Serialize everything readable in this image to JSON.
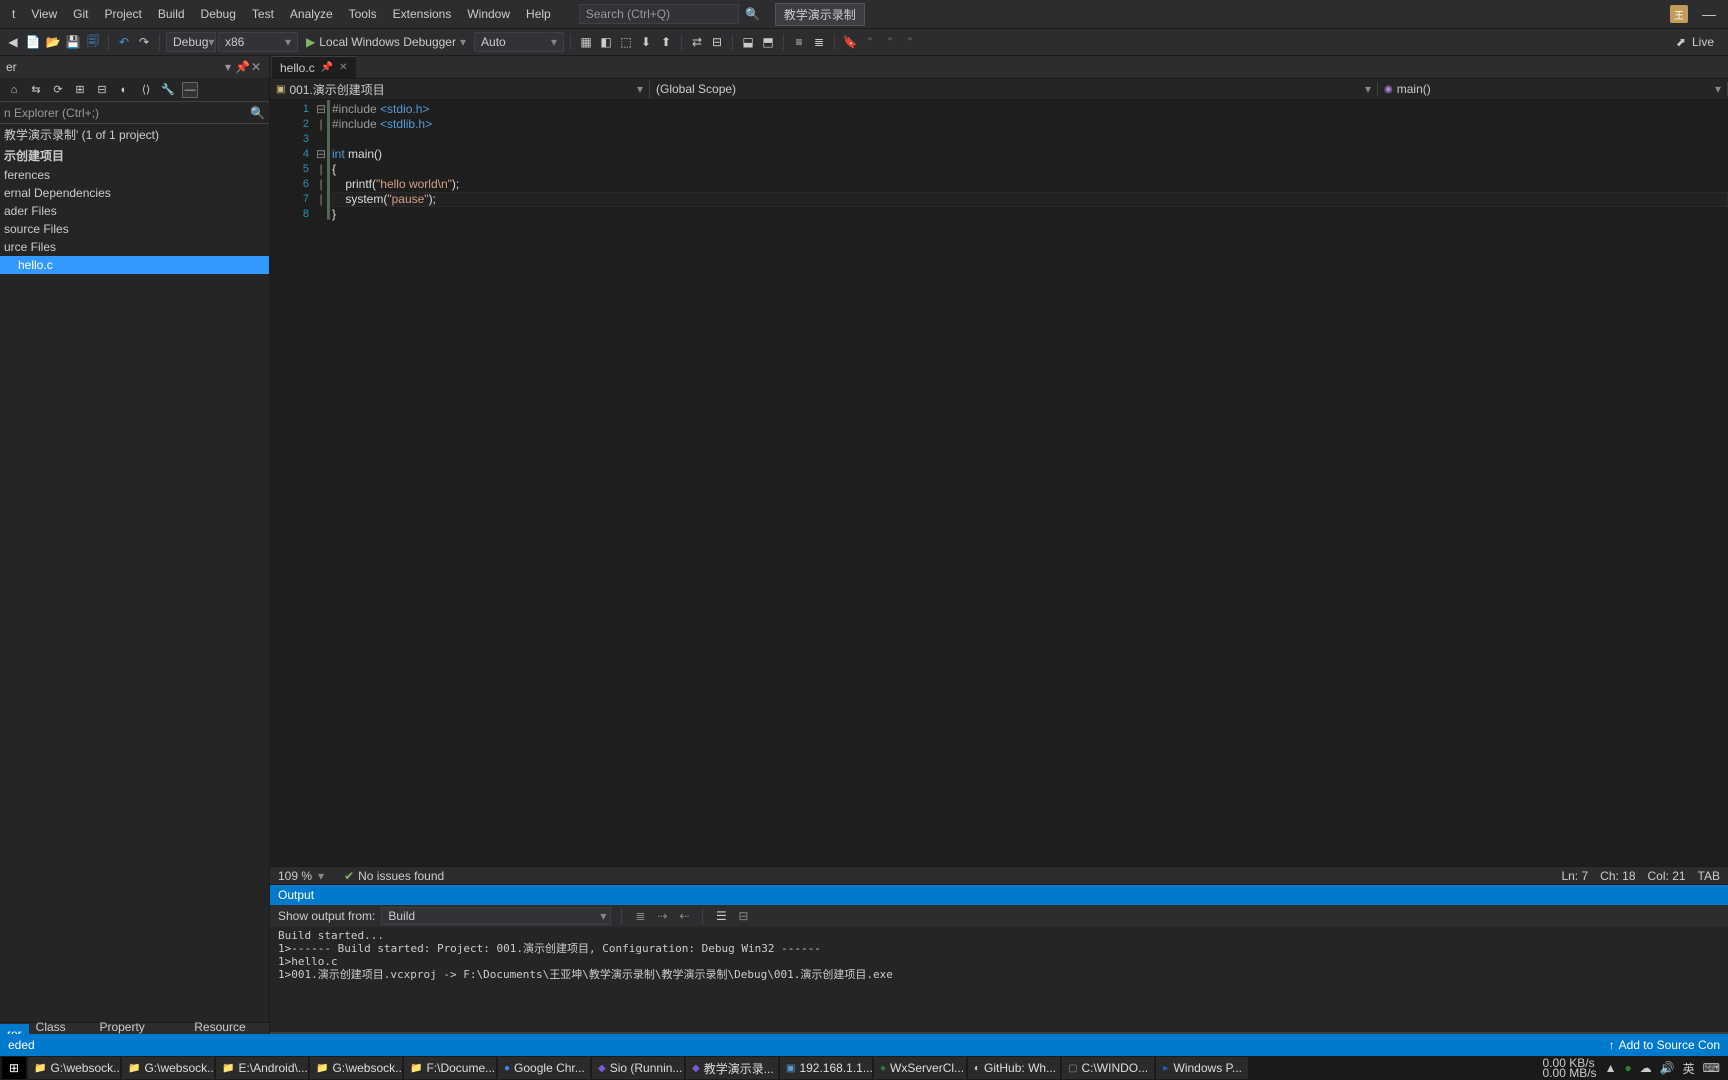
{
  "menu": [
    "t",
    "View",
    "Git",
    "Project",
    "Build",
    "Debug",
    "Test",
    "Analyze",
    "Tools",
    "Extensions",
    "Window",
    "Help"
  ],
  "search_placeholder": "Search (Ctrl+Q)",
  "title_chip": "教学演示录制",
  "user_badge": "王",
  "toolbar": {
    "config": "Debug",
    "platform": "x86",
    "debugger": "Local Windows Debugger",
    "auto": "Auto",
    "live": "Live"
  },
  "solution_explorer": {
    "title": "er",
    "search_hint": "n Explorer (Ctrl+;)",
    "tree": [
      {
        "label": "教学演示录制' (1 of 1 project)",
        "indent": 0
      },
      {
        "label": "示创建项目",
        "indent": 0,
        "bold": true
      },
      {
        "label": "ferences",
        "indent": 0
      },
      {
        "label": "ernal Dependencies",
        "indent": 0
      },
      {
        "label": "ader Files",
        "indent": 0
      },
      {
        "label": "source Files",
        "indent": 0
      },
      {
        "label": "urce Files",
        "indent": 0
      },
      {
        "label": "hello.c",
        "indent": 1,
        "selected": true
      }
    ],
    "tabs": [
      "rer",
      "Class View",
      "Property Manager",
      "Resource View"
    ]
  },
  "editor": {
    "tab_name": "hello.c",
    "nav_project": "001.演示创建项目",
    "nav_scope": "(Global Scope)",
    "nav_func": "main()",
    "lines": [
      {
        "n": 1,
        "fold": "⊟",
        "segs": [
          {
            "t": "#include ",
            "c": "pp"
          },
          {
            "t": "<stdio.h>",
            "c": "inc"
          }
        ]
      },
      {
        "n": 2,
        "fold": "|",
        "segs": [
          {
            "t": "#include ",
            "c": "pp"
          },
          {
            "t": "<stdlib.h>",
            "c": "inc"
          }
        ]
      },
      {
        "n": 3,
        "fold": "",
        "segs": [
          {
            "t": "",
            "c": "txt"
          }
        ]
      },
      {
        "n": 4,
        "fold": "⊟",
        "segs": [
          {
            "t": "int",
            "c": "kw"
          },
          {
            "t": " main()",
            "c": "txt"
          }
        ]
      },
      {
        "n": 5,
        "fold": "|",
        "segs": [
          {
            "t": "{",
            "c": "txt"
          }
        ]
      },
      {
        "n": 6,
        "fold": "|",
        "segs": [
          {
            "t": "    printf",
            "c": "txt"
          },
          {
            "t": "(",
            "c": "txt"
          },
          {
            "t": "\"hello world\\n\"",
            "c": "str"
          },
          {
            "t": ");",
            "c": "txt"
          }
        ]
      },
      {
        "n": 7,
        "fold": "|",
        "segs": [
          {
            "t": "    system",
            "c": "txt"
          },
          {
            "t": "(",
            "c": "txt"
          },
          {
            "t": "\"pause\"",
            "c": "str"
          },
          {
            "t": ");",
            "c": "txt"
          }
        ],
        "current": true
      },
      {
        "n": 8,
        "fold": "",
        "segs": [
          {
            "t": "}",
            "c": "txt"
          }
        ]
      }
    ],
    "status": {
      "zoom": "109 %",
      "issues": "No issues found",
      "ln": "Ln: 7",
      "ch": "Ch: 18",
      "col": "Col: 21",
      "tab": "TAB"
    }
  },
  "output": {
    "title": "Output",
    "from_label": "Show output from:",
    "from_value": "Build",
    "lines": [
      "Build started...",
      "1>------ Build started: Project: 001.演示创建项目, Configuration: Debug Win32 ------",
      "1>hello.c",
      "1>001.演示创建项目.vcxproj -> F:\\Documents\\王亚坤\\教学演示录制\\教学演示录制\\Debug\\001.演示创建项目.exe"
    ]
  },
  "statusbar": {
    "left": "eded",
    "add": "Add to Source Con"
  },
  "taskbar": {
    "items": [
      {
        "icon": "📁",
        "color": "#f8d775",
        "label": "G:\\websock..."
      },
      {
        "icon": "📁",
        "color": "#f8d775",
        "label": "G:\\websock..."
      },
      {
        "icon": "📁",
        "color": "#f8d775",
        "label": "E:\\Android\\..."
      },
      {
        "icon": "📁",
        "color": "#f8d775",
        "label": "G:\\websock..."
      },
      {
        "icon": "📁",
        "color": "#f8d775",
        "label": "F:\\Docume..."
      },
      {
        "icon": "●",
        "color": "#4285f4",
        "label": "Google Chr..."
      },
      {
        "icon": "◆",
        "color": "#7b5cd6",
        "label": "Sio (Runnin..."
      },
      {
        "icon": "◆",
        "color": "#7b5cd6",
        "label": "教学演示录..."
      },
      {
        "icon": "▣",
        "color": "#5a9fd4",
        "label": "192.168.1.1..."
      },
      {
        "icon": "●",
        "color": "#2e7d32",
        "label": "WxServerCl..."
      },
      {
        "icon": "◐",
        "color": "#ccc",
        "label": "GitHub: Wh..."
      },
      {
        "icon": "▢",
        "color": "#888",
        "label": "C:\\WINDO..."
      },
      {
        "icon": "▸",
        "color": "#2962c7",
        "label": "Windows P..."
      }
    ],
    "tray": {
      "net1": "0.00 KB/s",
      "net2": "0.00 MB/s",
      "ime": "英"
    }
  }
}
